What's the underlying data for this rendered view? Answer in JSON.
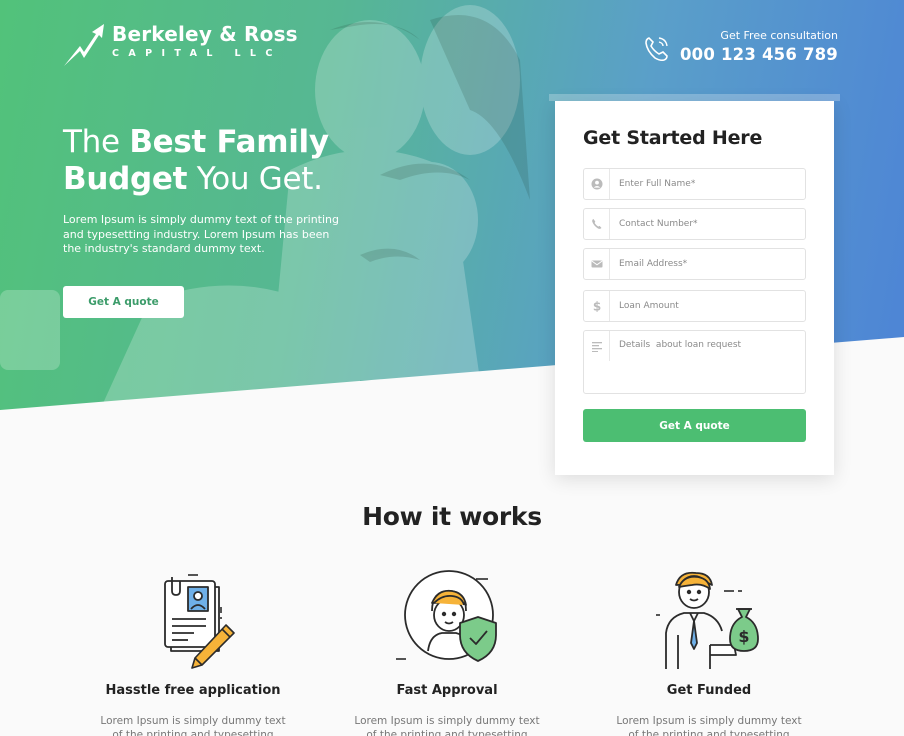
{
  "header": {
    "brand_name": "Berkeley & Ross",
    "brand_sub": "CAPITAL LLC",
    "contact_label": "Get Free consultation",
    "contact_number": "000 123 456 789"
  },
  "hero": {
    "title_line1_light": "The",
    "title_line1_bold": "Best Family",
    "title_line2_bold": "Budget",
    "title_line2_light": "You Get.",
    "description": "Lorem Ipsum is simply dummy text of the printing and typesetting industry. Lorem Ipsum has been the industry's standard dummy text.",
    "button_label": "Get A quote"
  },
  "form": {
    "title": "Get Started Here",
    "fields": [
      {
        "placeholder": "Enter Full Name*",
        "icon": "user-icon"
      },
      {
        "placeholder": "Contact Number*",
        "icon": "phone-icon"
      },
      {
        "placeholder": "Email Address*",
        "icon": "envelope-icon"
      },
      {
        "placeholder": "Loan Amount",
        "icon": "dollar-icon"
      },
      {
        "placeholder": "Details  about loan request",
        "icon": "text-lines-icon"
      }
    ],
    "submit_label": "Get A quote"
  },
  "how": {
    "title": "How it works",
    "steps": [
      {
        "title": "Hasstle free application",
        "desc": "Lorem Ipsum is simply dummy text of the printing and typesetting industry",
        "icon": "application-document-icon"
      },
      {
        "title": "Fast Approval",
        "desc": "Lorem Ipsum is simply dummy text of the printing and typesetting industry",
        "icon": "approval-shield-icon"
      },
      {
        "title": "Get Funded",
        "desc": "Lorem Ipsum is simply dummy text of the printing and typesetting industry",
        "icon": "money-bag-icon"
      }
    ]
  },
  "colors": {
    "gradient_start": "#52c27a",
    "gradient_end": "#4d84d6",
    "accent_green": "#4cbe72"
  }
}
